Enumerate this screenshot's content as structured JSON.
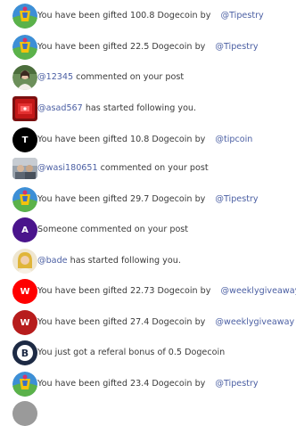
{
  "notifications": [
    {
      "avatar": "tipestry-logo-icon",
      "pre": "You have been gifted  100.8 Dogecoin by ",
      "mention": "@Tipestry",
      "post": ""
    },
    {
      "avatar": "tipestry-logo-icon",
      "pre": "You have been gifted  22.5 Dogecoin by ",
      "mention": "@Tipestry",
      "post": ""
    },
    {
      "avatar": "user-photo-icon",
      "pre": "",
      "mention": "@12345",
      "post": " commented on your post"
    },
    {
      "avatar": "user-photo-icon",
      "pre": "",
      "mention": "@asad567",
      "post": " has started following you."
    },
    {
      "avatar": "letter-avatar",
      "letter": "T",
      "pre": "You have been gifted  10.8 Dogecoin by ",
      "mention": "@tipcoin",
      "post": ""
    },
    {
      "avatar": "user-photo-icon",
      "pre": "",
      "mention": "@wasi180651",
      "post": " commented on your post"
    },
    {
      "avatar": "tipestry-logo-icon",
      "pre": "You have been gifted  29.7 Dogecoin by ",
      "mention": "@Tipestry",
      "post": ""
    },
    {
      "avatar": "letter-avatar",
      "letter": "A",
      "pre": "Someone commented on your post",
      "mention": "",
      "post": ""
    },
    {
      "avatar": "user-photo-icon",
      "pre": "",
      "mention": "@bade",
      "post": " has started following you."
    },
    {
      "avatar": "letter-avatar",
      "letter": "W",
      "pre": "You have been gifted  22.73 Dogecoin by ",
      "mention": "@weeklygiveaway",
      "post": ""
    },
    {
      "avatar": "letter-avatar",
      "letter": "W",
      "pre": "You have been gifted  27.4 Dogecoin by ",
      "mention": "@weeklygiveaway",
      "post": ""
    },
    {
      "avatar": "bitcoin-icon",
      "letter": "B",
      "pre": "You just got a referal bonus of 0.5 Dogecoin",
      "mention": "",
      "post": ""
    },
    {
      "avatar": "tipestry-logo-icon",
      "pre": "You have been gifted  23.4 Dogecoin by ",
      "mention": "@Tipestry",
      "post": ""
    }
  ],
  "colors": {
    "text": "#3a3a3a",
    "mention": "#4b5fa3",
    "avatar_black": "#000000",
    "avatar_purple": "#4a148c",
    "avatar_red": "#ff0000",
    "avatar_darkred": "#b71c1c",
    "avatar_navy": "#1d2a44"
  }
}
